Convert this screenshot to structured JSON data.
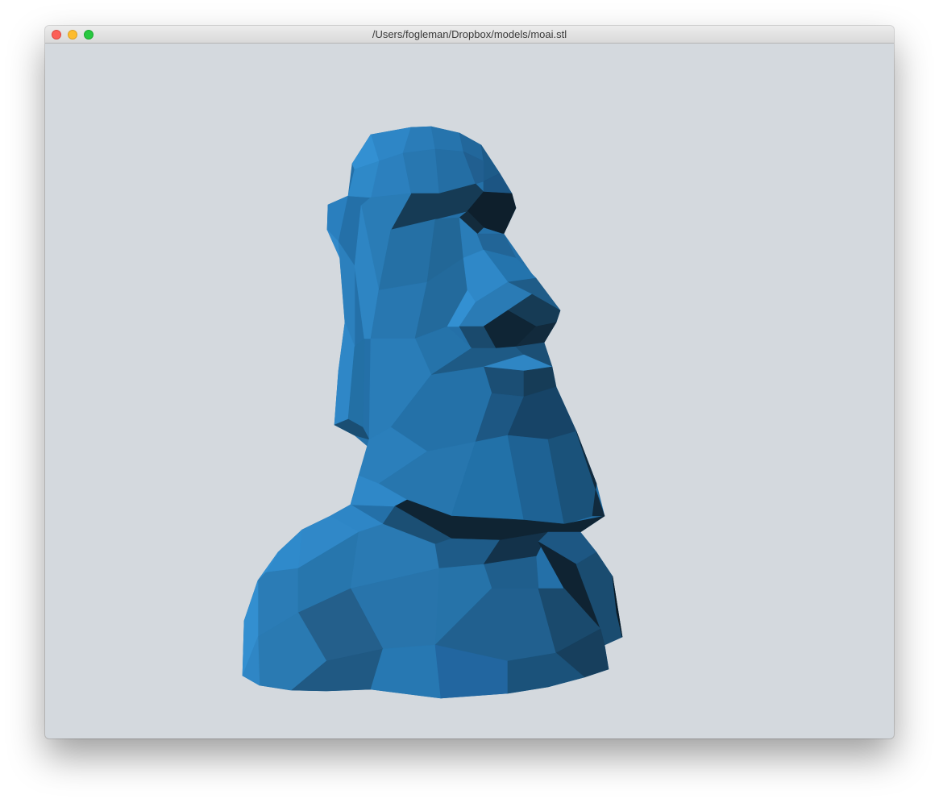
{
  "window": {
    "title": "/Users/fogleman/Dropbox/models/moai.stl"
  },
  "traffic_lights": {
    "close_icon": "close-icon",
    "minimize_icon": "minimize-icon",
    "zoom_icon": "zoom-icon"
  },
  "viewport": {
    "background_color": "#d4d9de",
    "model_color": "#2b7fbb"
  }
}
